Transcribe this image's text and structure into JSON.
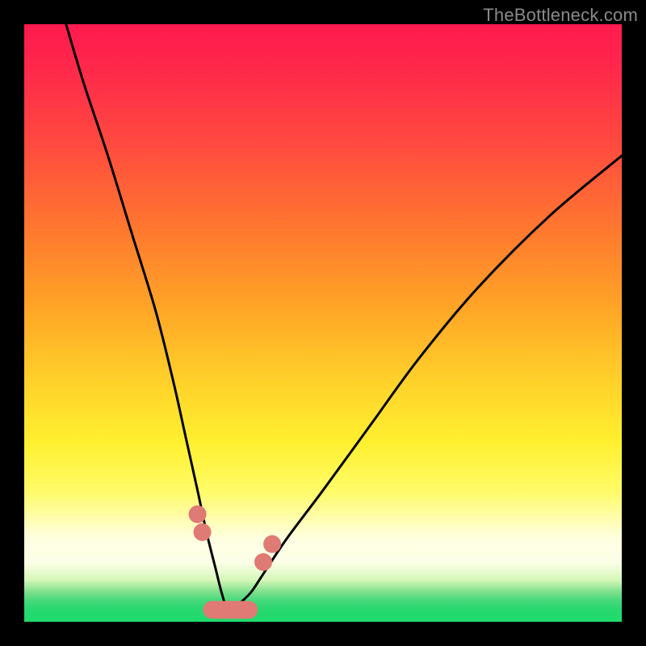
{
  "watermark": "TheBottleneck.com",
  "chart_data": {
    "type": "line",
    "title": "",
    "xlabel": "",
    "ylabel": "",
    "xlim": [
      0,
      100
    ],
    "ylim": [
      0,
      100
    ],
    "series": [
      {
        "name": "bottleneck-curve",
        "x": [
          7,
          10,
          14,
          18,
          22,
          25,
          27,
          29,
          30.5,
          32,
          33,
          34,
          35,
          36,
          38,
          40,
          44,
          50,
          58,
          66,
          76,
          88,
          100
        ],
        "y": [
          100,
          90,
          78,
          65,
          52,
          40,
          31,
          22,
          15,
          9,
          5,
          2,
          2,
          3,
          5,
          8,
          14,
          22,
          33,
          44,
          56,
          68,
          78
        ]
      }
    ],
    "markers": [
      {
        "name": "left-dot-upper",
        "x": 29.0,
        "y": 18
      },
      {
        "name": "left-dot-lower",
        "x": 29.8,
        "y": 15
      },
      {
        "name": "right-dot-lower",
        "x": 40.0,
        "y": 10
      },
      {
        "name": "right-dot-upper",
        "x": 41.5,
        "y": 13
      }
    ],
    "floor_segment": {
      "name": "valley-cluster",
      "x_start": 31,
      "x_end": 38,
      "y": 2
    }
  }
}
